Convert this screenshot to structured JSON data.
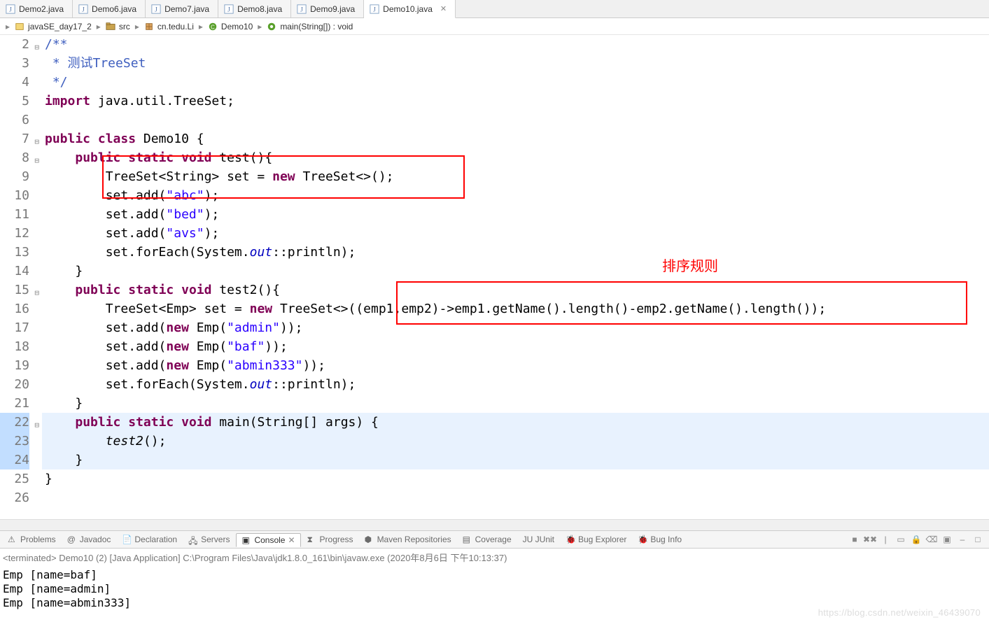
{
  "tabs": [
    {
      "label": "Demo2.java",
      "active": false
    },
    {
      "label": "Demo6.java",
      "active": false
    },
    {
      "label": "Demo7.java",
      "active": false
    },
    {
      "label": "Demo8.java",
      "active": false
    },
    {
      "label": "Demo9.java",
      "active": false
    },
    {
      "label": "Demo10.java",
      "active": true
    }
  ],
  "breadcrumb": [
    {
      "icon": "project-icon",
      "label": "javaSE_day17_2"
    },
    {
      "icon": "folder-icon",
      "label": "src"
    },
    {
      "icon": "package-icon",
      "label": "cn.tedu.Li"
    },
    {
      "icon": "class-icon",
      "label": "Demo10"
    },
    {
      "icon": "method-icon",
      "label": "main(String[]) : void"
    }
  ],
  "annotations": {
    "sort_rule_label": "排序规则"
  },
  "code_lines": [
    {
      "n": 2,
      "fold": true,
      "segs": [
        {
          "t": "/**",
          "c": "cm"
        }
      ]
    },
    {
      "n": 3,
      "segs": [
        {
          "t": " * 测试TreeSet",
          "c": "cm"
        }
      ]
    },
    {
      "n": 4,
      "segs": [
        {
          "t": " */",
          "c": "cm"
        }
      ]
    },
    {
      "n": 5,
      "segs": [
        {
          "t": "import",
          "c": "kw"
        },
        {
          "t": " java.util.TreeSet;"
        }
      ]
    },
    {
      "n": 6,
      "segs": []
    },
    {
      "n": 7,
      "fold": true,
      "segs": [
        {
          "t": "public",
          "c": "kw"
        },
        {
          "t": " "
        },
        {
          "t": "class",
          "c": "kw"
        },
        {
          "t": " Demo10 {"
        }
      ]
    },
    {
      "n": 8,
      "fold": true,
      "segs": [
        {
          "t": "    "
        },
        {
          "t": "public",
          "c": "kw"
        },
        {
          "t": " "
        },
        {
          "t": "static",
          "c": "kw"
        },
        {
          "t": " "
        },
        {
          "t": "void",
          "c": "kw"
        },
        {
          "t": " test(){"
        }
      ]
    },
    {
      "n": 9,
      "segs": [
        {
          "t": "        TreeSet<String> set = "
        },
        {
          "t": "new",
          "c": "kw"
        },
        {
          "t": " TreeSet<>();"
        }
      ]
    },
    {
      "n": 10,
      "segs": [
        {
          "t": "        set.add("
        },
        {
          "t": "\"abc\"",
          "c": "str"
        },
        {
          "t": ");"
        }
      ]
    },
    {
      "n": 11,
      "segs": [
        {
          "t": "        set.add("
        },
        {
          "t": "\"bed\"",
          "c": "str"
        },
        {
          "t": ");"
        }
      ]
    },
    {
      "n": 12,
      "segs": [
        {
          "t": "        set.add("
        },
        {
          "t": "\"avs\"",
          "c": "str"
        },
        {
          "t": ");"
        }
      ]
    },
    {
      "n": 13,
      "segs": [
        {
          "t": "        set.forEach(System."
        },
        {
          "t": "out",
          "c": "fld"
        },
        {
          "t": "::println);"
        }
      ]
    },
    {
      "n": 14,
      "segs": [
        {
          "t": "    }"
        }
      ]
    },
    {
      "n": 15,
      "fold": true,
      "segs": [
        {
          "t": "    "
        },
        {
          "t": "public",
          "c": "kw"
        },
        {
          "t": " "
        },
        {
          "t": "static",
          "c": "kw"
        },
        {
          "t": " "
        },
        {
          "t": "void",
          "c": "kw"
        },
        {
          "t": " test2(){"
        }
      ]
    },
    {
      "n": 16,
      "segs": [
        {
          "t": "        TreeSet<Emp> set = "
        },
        {
          "t": "new",
          "c": "kw"
        },
        {
          "t": " TreeSet<>((emp1,emp2)->emp1.getName().length()-emp2.getName().length());"
        }
      ]
    },
    {
      "n": 17,
      "segs": [
        {
          "t": "        set.add("
        },
        {
          "t": "new",
          "c": "kw"
        },
        {
          "t": " Emp("
        },
        {
          "t": "\"admin\"",
          "c": "str"
        },
        {
          "t": "));"
        }
      ]
    },
    {
      "n": 18,
      "segs": [
        {
          "t": "        set.add("
        },
        {
          "t": "new",
          "c": "kw"
        },
        {
          "t": " Emp("
        },
        {
          "t": "\"baf\"",
          "c": "str"
        },
        {
          "t": "));"
        }
      ]
    },
    {
      "n": 19,
      "segs": [
        {
          "t": "        set.add("
        },
        {
          "t": "new",
          "c": "kw"
        },
        {
          "t": " Emp("
        },
        {
          "t": "\"abmin333\"",
          "c": "str"
        },
        {
          "t": "));"
        }
      ]
    },
    {
      "n": 20,
      "segs": [
        {
          "t": "        set.forEach(System."
        },
        {
          "t": "out",
          "c": "fld"
        },
        {
          "t": "::println);"
        }
      ]
    },
    {
      "n": 21,
      "segs": [
        {
          "t": "    }"
        }
      ]
    },
    {
      "n": 22,
      "fold": true,
      "hl": true,
      "segs": [
        {
          "t": "    "
        },
        {
          "t": "public",
          "c": "kw"
        },
        {
          "t": " "
        },
        {
          "t": "static",
          "c": "kw"
        },
        {
          "t": " "
        },
        {
          "t": "void",
          "c": "kw"
        },
        {
          "t": " main(String[] args) {"
        }
      ]
    },
    {
      "n": 23,
      "hl": true,
      "segs": [
        {
          "t": "        "
        },
        {
          "t": "test2",
          "c": "it"
        },
        {
          "t": "();"
        }
      ]
    },
    {
      "n": 24,
      "hl": true,
      "segs": [
        {
          "t": "    }"
        }
      ]
    },
    {
      "n": 25,
      "segs": [
        {
          "t": "}"
        }
      ]
    },
    {
      "n": 26,
      "segs": []
    }
  ],
  "views": [
    {
      "label": "Problems",
      "icon": "problems-icon"
    },
    {
      "label": "Javadoc",
      "icon": "javadoc-icon"
    },
    {
      "label": "Declaration",
      "icon": "declaration-icon"
    },
    {
      "label": "Servers",
      "icon": "servers-icon"
    },
    {
      "label": "Console",
      "icon": "console-icon",
      "active": true
    },
    {
      "label": "Progress",
      "icon": "progress-icon"
    },
    {
      "label": "Maven Repositories",
      "icon": "maven-icon"
    },
    {
      "label": "Coverage",
      "icon": "coverage-icon"
    },
    {
      "label": "JUnit",
      "icon": "junit-icon"
    },
    {
      "label": "Bug Explorer",
      "icon": "bug-explorer-icon"
    },
    {
      "label": "Bug Info",
      "icon": "bug-info-icon"
    }
  ],
  "console": {
    "status": "<terminated> Demo10 (2) [Java Application] C:\\Program Files\\Java\\jdk1.8.0_161\\bin\\javaw.exe (2020年8月6日 下午10:13:37)",
    "output": [
      "Emp [name=baf]",
      "Emp [name=admin]",
      "Emp [name=abmin333]"
    ]
  },
  "watermark": "https://blog.csdn.net/weixin_46439070"
}
